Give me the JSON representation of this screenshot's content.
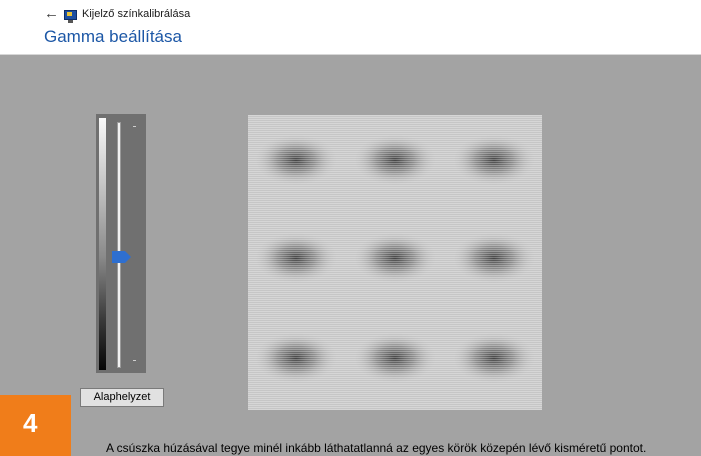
{
  "header": {
    "app_title": "Kijelző színkalibrálása",
    "page_title": "Gamma beállítása",
    "back_icon": "arrow-left-icon",
    "app_icon": "monitor-icon"
  },
  "slider": {
    "value_fraction": 0.55,
    "thumb_color": "#2e6fd0"
  },
  "reset_button": {
    "label": "Alaphelyzet"
  },
  "step_badge": {
    "number": "4",
    "color": "#f07d1a"
  },
  "instruction": "A csúszka húzásával tegye minél inkább láthatatlanná az egyes körök közepén lévő kisméretű pontot."
}
